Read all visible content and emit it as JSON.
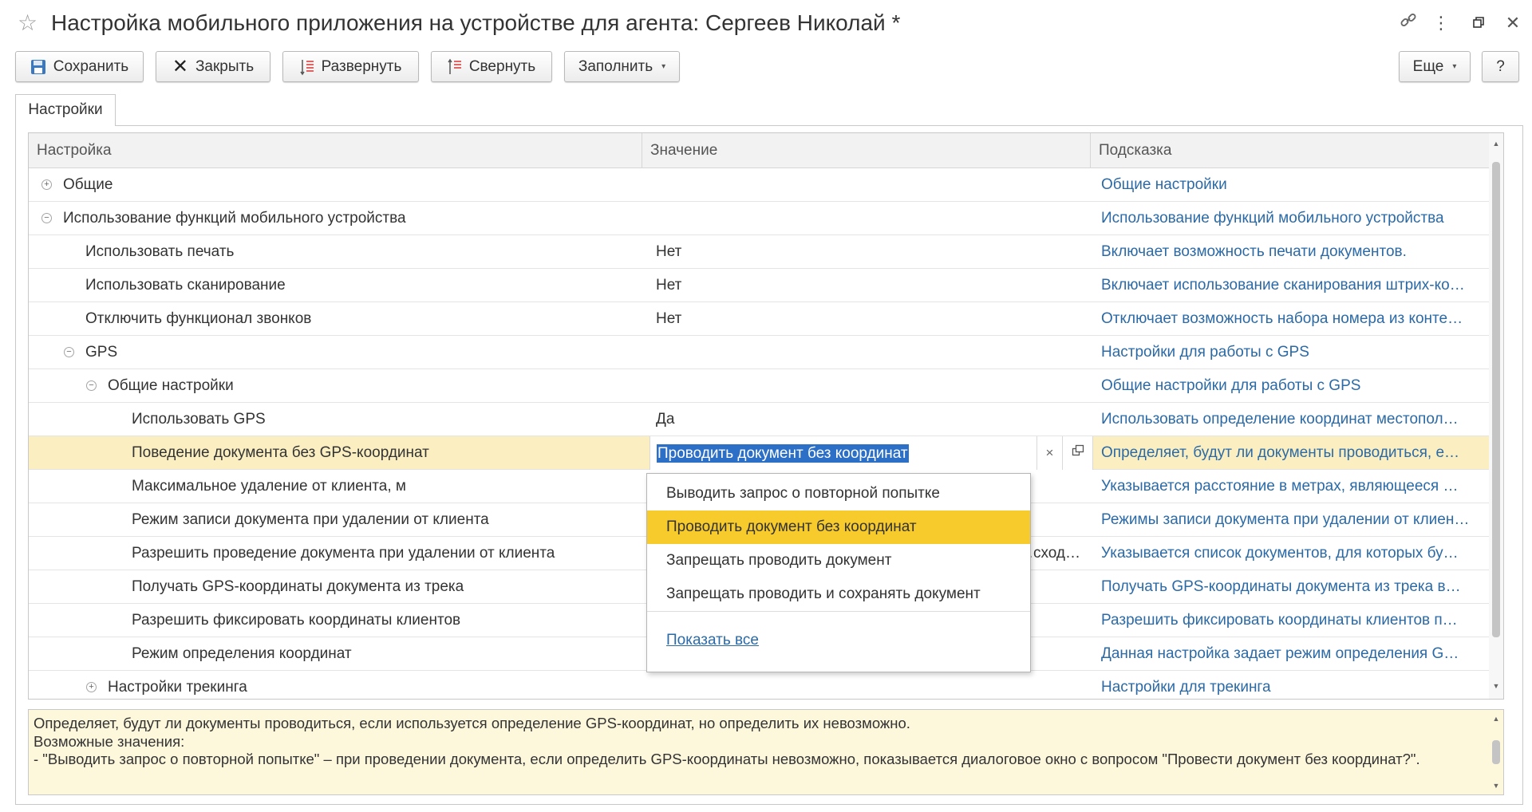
{
  "window": {
    "title": "Настройка мобильного приложения на устройстве для агента: Сергеев Николай *"
  },
  "toolbar": {
    "save": "Сохранить",
    "close": "Закрыть",
    "expand": "Развернуть",
    "collapse": "Свернуть",
    "fill": "Заполнить",
    "more": "Еще",
    "help": "?"
  },
  "tabs": [
    {
      "label": "Настройки"
    }
  ],
  "table": {
    "columns": [
      "Настройка",
      "Значение",
      "Подсказка"
    ],
    "rows": [
      {
        "name": "Общие",
        "value": "",
        "hint": "Общие настройки",
        "level": 0,
        "toggle": "plus"
      },
      {
        "name": "Использование функций мобильного устройства",
        "value": "",
        "hint": "Использование функций мобильного устройства",
        "level": 0,
        "toggle": "minus"
      },
      {
        "name": "Использовать печать",
        "value": "Нет",
        "hint": "Включает возможность печати документов.",
        "level": 1,
        "toggle": ""
      },
      {
        "name": "Использовать сканирование",
        "value": "Нет",
        "hint": "Включает использование сканирования штрих-ко…",
        "level": 1,
        "toggle": ""
      },
      {
        "name": "Отключить функционал звонков",
        "value": "Нет",
        "hint": "Отключает возможность набора номера из конте…",
        "level": 1,
        "toggle": ""
      },
      {
        "name": "GPS",
        "value": "",
        "hint": "Настройки для работы с GPS",
        "level": 1,
        "toggle": "minus"
      },
      {
        "name": "Общие настройки",
        "value": "",
        "hint": "Общие настройки для работы с GPS",
        "level": 2,
        "toggle": "minus"
      },
      {
        "name": "Использовать GPS",
        "value": "Да",
        "hint": "Использовать определение координат местопол…",
        "level": 3,
        "toggle": ""
      },
      {
        "name": "Поведение документа без GPS-координат",
        "value": "Проводить документ без координат",
        "hint": "Определяет, будут ли документы проводиться, е…",
        "level": 3,
        "toggle": "",
        "selected": true
      },
      {
        "name": "Максимальное удаление от клиента, м",
        "value": "",
        "hint": "Указывается расстояние в метрах, являющееся …",
        "level": 3,
        "toggle": ""
      },
      {
        "name": "Режим записи документа при удалении от клиента",
        "value": "",
        "hint": "Режимы записи документа при удалении от клиен…",
        "level": 3,
        "toggle": ""
      },
      {
        "name": "Разрешить проведение документа при удалении от клиента",
        "value": "…сход…",
        "hint": "Указывается список документов, для которых бу…",
        "level": 3,
        "toggle": ""
      },
      {
        "name": "Получать GPS-координаты документа из трека",
        "value": "",
        "hint": "Получать GPS-координаты документа из трека в…",
        "level": 3,
        "toggle": ""
      },
      {
        "name": "Разрешить фиксировать координаты клиентов",
        "value": "",
        "hint": "Разрешить фиксировать координаты клиентов п…",
        "level": 3,
        "toggle": ""
      },
      {
        "name": "Режим определения координат",
        "value": "",
        "hint": "Данная настройка задает режим определения G…",
        "level": 3,
        "toggle": ""
      },
      {
        "name": "Настройки трекинга",
        "value": "",
        "hint": "Настройки для трекинга",
        "level": 2,
        "toggle": "plus"
      }
    ]
  },
  "dropdown": {
    "options": [
      "Выводить запрос о повторной попытке",
      "Проводить документ без координат",
      "Запрещать проводить документ",
      "Запрещать проводить и сохранять документ"
    ],
    "highlighted": "Проводить документ без координат",
    "show_all": "Показать все"
  },
  "hint_panel": {
    "text": "Определяет, будут ли документы проводиться, если используется определение GPS-координат, но определить их невозможно.\nВозможные значения:\n- \"Выводить запрос о повторной попытке\" – при проведении документа, если определить GPS-координаты невозможно, показывается диалоговое окно с вопросом \"Провести документ без координат?\"."
  },
  "colors": {
    "selected_row": "#fbefc2",
    "highlight_option": "#f8cb2c",
    "hint_link": "#2b6aa6",
    "hint_panel_bg": "#fdf7dc"
  }
}
